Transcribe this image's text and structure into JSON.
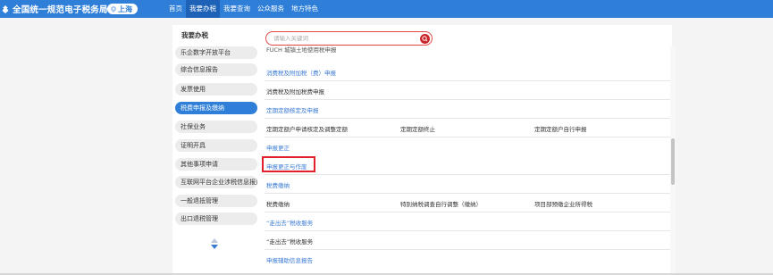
{
  "header": {
    "site_title": "全国统一规范电子税务局",
    "region": "上海",
    "icons": {
      "brand": "emblem-icon",
      "region": "location-pin-icon"
    },
    "nav": [
      {
        "label": "首页",
        "active": false
      },
      {
        "label": "我要办税",
        "active": true
      },
      {
        "label": "我要查询",
        "active": false
      },
      {
        "label": "公众服务",
        "active": false
      },
      {
        "label": "地方特色",
        "active": false
      }
    ],
    "colors": {
      "bar": "#2f7fd8",
      "active": "#1e62b8"
    }
  },
  "sidebar": {
    "title": "我要办税",
    "items": [
      {
        "label": "乐企数字开放平台",
        "active": false
      },
      {
        "label": "综合信息报告",
        "active": false
      },
      {
        "label": "发票使用",
        "active": false
      },
      {
        "label": "税费申报及缴纳",
        "active": true
      },
      {
        "label": "社保业务",
        "active": false
      },
      {
        "label": "证明开具",
        "active": false
      },
      {
        "label": "其他事项申请",
        "active": false
      },
      {
        "label": "互联网平台企业涉税信息报送",
        "active": false
      },
      {
        "label": "一般退抵管理",
        "active": false
      },
      {
        "label": "出口退税管理",
        "active": false
      }
    ],
    "scroll_icon": "up-down-arrows-icon"
  },
  "search": {
    "placeholder": "请输入关键词",
    "icon": "search-icon"
  },
  "content": {
    "partial_top": "FUCH 城镇土地使用税申报",
    "sections": [
      {
        "title": "消费税及附加税（费）申报",
        "items": [
          "消费税及附加税费申报"
        ]
      },
      {
        "title": "定期定额核定及申报",
        "items": [
          "定期定额户申请核定及调整定额",
          "定期定额终止",
          "定期定额户自行申报"
        ]
      },
      {
        "title": "申报更正",
        "items": [
          "申报更正与作废"
        ]
      },
      {
        "title": "税费缴纳",
        "items": [
          "税费缴纳",
          "特别纳税调查自行调整（缴纳）",
          "项目部预缴企业所得税"
        ]
      },
      {
        "title": "“走出去”税收服务",
        "items": [
          "“走出去”税收服务"
        ]
      },
      {
        "title": "申报辅助信息报告",
        "items": []
      }
    ],
    "link_color": "#3a7bd5",
    "highlight_color": "#e0202a"
  }
}
